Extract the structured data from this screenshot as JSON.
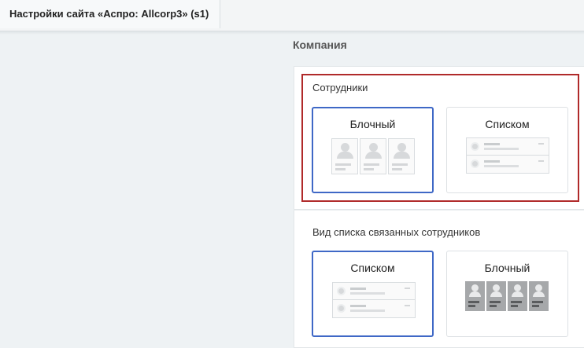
{
  "window": {
    "tab_title": "Настройки сайта «Аспро: Allcorp3» (s1)"
  },
  "section": {
    "title": "Компания"
  },
  "groups": [
    {
      "label": "Сотрудники",
      "options": [
        {
          "label": "Блочный",
          "selected": true,
          "preview": "block-preview"
        },
        {
          "label": "Списком",
          "selected": false,
          "preview": "list-preview"
        }
      ]
    },
    {
      "label": "Вид списка связанных сотрудников",
      "options": [
        {
          "label": "Списком",
          "selected": true,
          "preview": "list-preview"
        },
        {
          "label": "Блочный",
          "selected": false,
          "preview": "dark-block-preview"
        }
      ]
    }
  ],
  "colors": {
    "selected_border": "#3f68c6",
    "highlight_border": "#b02a2a"
  }
}
